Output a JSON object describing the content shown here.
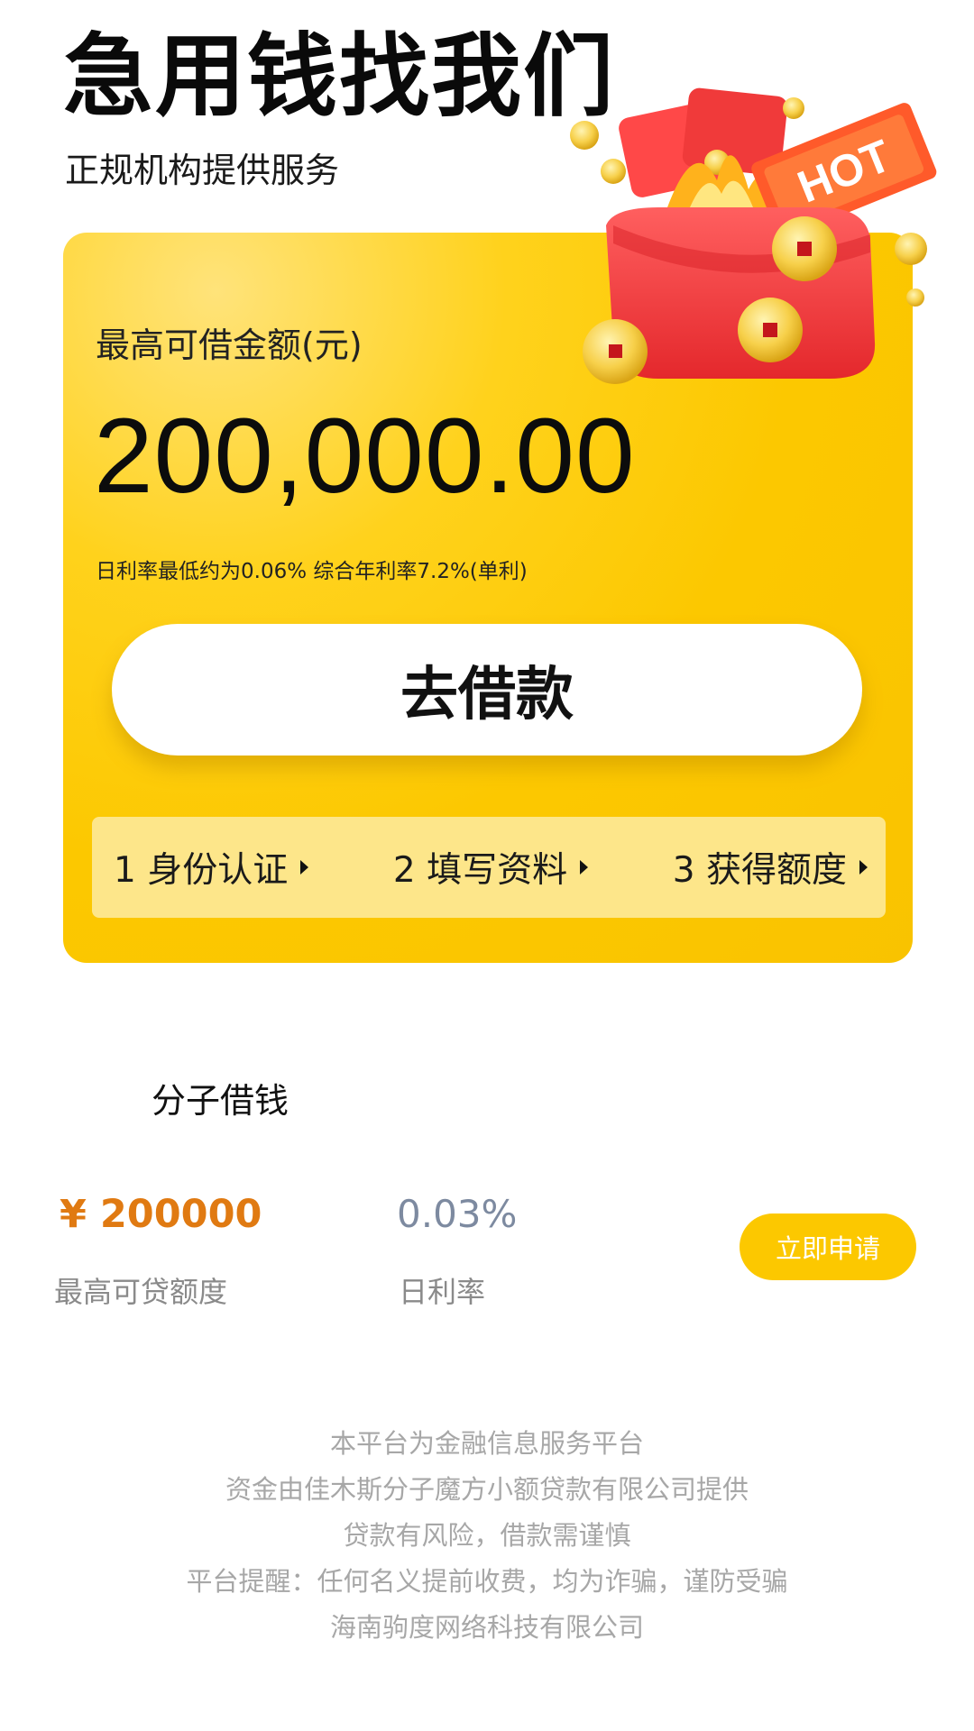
{
  "hero": {
    "title": "急用钱找我们",
    "subtitle": "正规机构提供服务"
  },
  "card": {
    "label": "最高可借金额(元)",
    "amount": "200,000.00",
    "rate_note": "日利率最低约为0.06% 综合年利率7.2%(单利)",
    "cta_label": "去借款",
    "steps": [
      {
        "label": "1 身份认证"
      },
      {
        "label": "2 填写资料"
      },
      {
        "label": "3 获得额度"
      }
    ],
    "illustration": {
      "name": "red-envelope-icon",
      "tag_text": "HOT"
    }
  },
  "product": {
    "name": "分子借钱",
    "amount": "¥ 200000",
    "amount_label": "最高可贷额度",
    "rate": "0.03%",
    "rate_label": "日利率",
    "apply_label": "立即申请"
  },
  "footer": {
    "lines": [
      "本平台为金融信息服务平台",
      "资金由佳木斯分子魔方小额贷款有限公司提供",
      "贷款有风险，借款需谨慎",
      "平台提醒：任何名义提前收费，均为诈骗，谨防受骗",
      "海南驹度网络科技有限公司"
    ]
  },
  "colors": {
    "accent": "#fcc800",
    "steps_bg": "#fde68a",
    "amount_orange": "#e07a12",
    "rate_slate": "#7d8aa0",
    "footer_gray": "#a7a7a7"
  }
}
